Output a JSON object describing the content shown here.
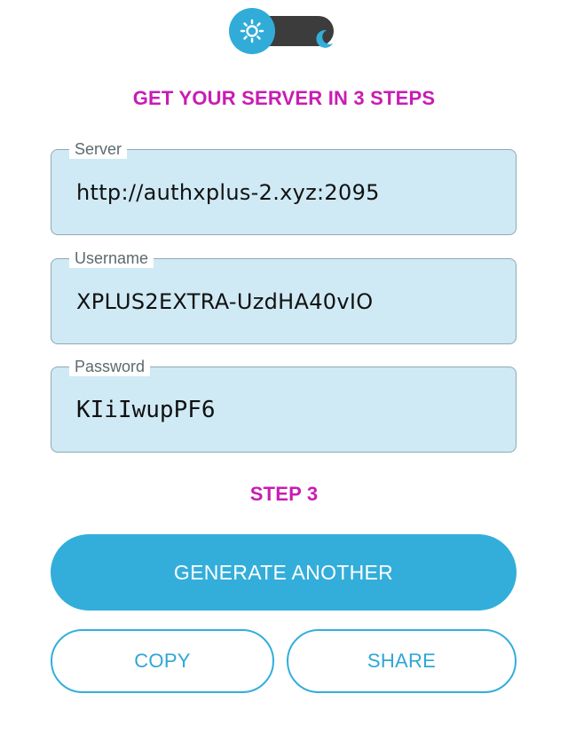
{
  "theme_toggle": {
    "light_icon": "sun-icon",
    "dark_icon": "moon-icon",
    "active": "light"
  },
  "heading": "GET YOUR SERVER IN 3 STEPS",
  "fields": {
    "server": {
      "label": "Server",
      "value": "http://authxplus-2.xyz:2095"
    },
    "username": {
      "label": "Username",
      "value": "XPLUS2EXTRA-UzdHA40vIO"
    },
    "password": {
      "label": "Password",
      "value": "KIiIwupPF6"
    }
  },
  "step_label": "STEP 3",
  "buttons": {
    "generate": "GENERATE ANOTHER",
    "copy": "COPY",
    "share": "SHARE"
  },
  "colors": {
    "accent": "#33aedb",
    "heading": "#c81cb4",
    "field_bg": "#cfeaf5",
    "toggle_track": "#3c3c3c"
  }
}
